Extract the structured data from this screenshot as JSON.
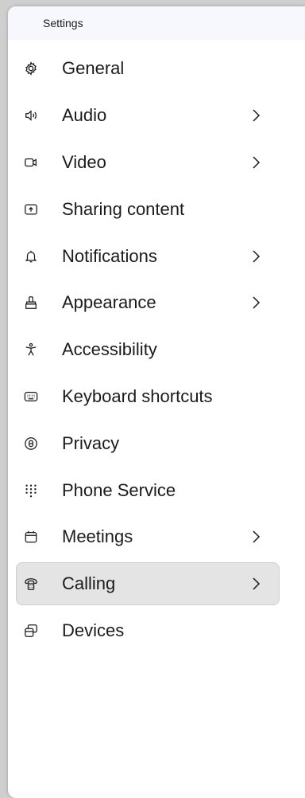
{
  "panel": {
    "title": "Settings"
  },
  "menu": {
    "items": [
      {
        "label": "General",
        "icon": "gear-icon"
      },
      {
        "label": "Audio",
        "icon": "speaker-icon",
        "chevron": true
      },
      {
        "label": "Video",
        "icon": "video-camera-icon",
        "chevron": true
      },
      {
        "label": "Sharing content",
        "icon": "share-screen-icon"
      },
      {
        "label": "Notifications",
        "icon": "bell-icon",
        "chevron": true
      },
      {
        "label": "Appearance",
        "icon": "paint-icon",
        "chevron": true
      },
      {
        "label": "Accessibility",
        "icon": "accessibility-icon"
      },
      {
        "label": "Keyboard shortcuts",
        "icon": "keyboard-icon"
      },
      {
        "label": "Privacy",
        "icon": "privacy-icon"
      },
      {
        "label": "Phone Service",
        "icon": "dialpad-icon"
      },
      {
        "label": "Meetings",
        "icon": "calendar-icon",
        "chevron": true
      },
      {
        "label": "Calling",
        "icon": "phone-icon",
        "chevron": true,
        "selected": true
      },
      {
        "label": "Devices",
        "icon": "devices-icon"
      }
    ]
  }
}
